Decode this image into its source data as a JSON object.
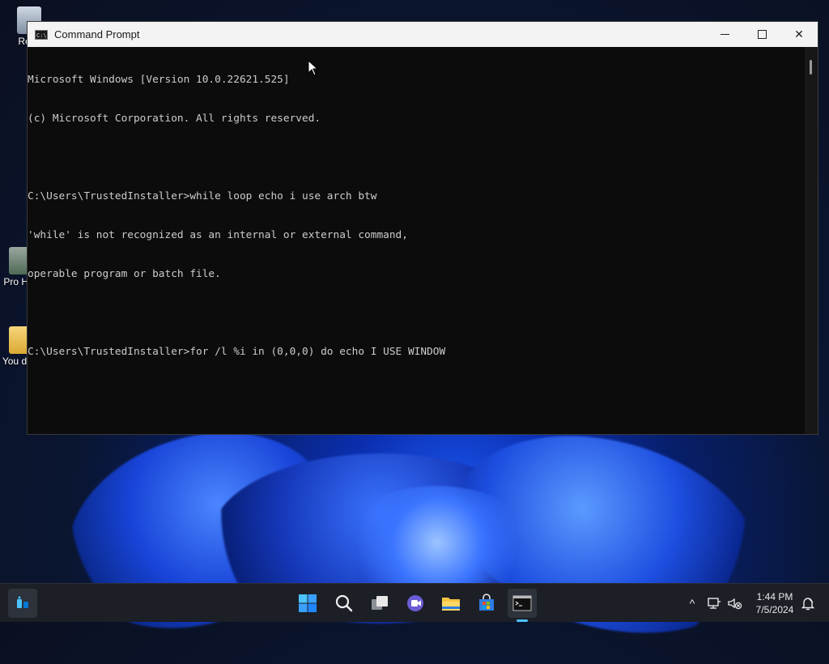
{
  "desktop": {
    "icons": [
      {
        "label": "Recy",
        "icon": "recycle-bin-icon"
      },
      {
        "label": "Pro Hac",
        "icon": "shortcut-icon"
      },
      {
        "label": "You dele",
        "icon": "folder-icon"
      }
    ]
  },
  "window": {
    "title": "Command Prompt",
    "icon": "console-icon",
    "controls": {
      "minimize": "minimize-icon",
      "maximize": "maximize-icon",
      "close": "close-icon",
      "close_glyph": "✕"
    }
  },
  "console": {
    "lines": [
      "Microsoft Windows [Version 10.0.22621.525]",
      "(c) Microsoft Corporation. All rights reserved.",
      "",
      "C:\\Users\\TrustedInstaller>while loop echo i use arch btw",
      "'while' is not recognized as an internal or external command,",
      "operable program or batch file.",
      "",
      "C:\\Users\\TrustedInstaller>for /l %i in (0,0,0) do echo I USE WINDOW"
    ],
    "text_color": "#cccccc",
    "background": "#0c0c0c"
  },
  "taskbar": {
    "apps": [
      {
        "name": "widgets",
        "icon": "widgets-icon"
      },
      {
        "name": "start",
        "icon": "windows-start-icon"
      },
      {
        "name": "search",
        "icon": "search-icon"
      },
      {
        "name": "task-view",
        "icon": "task-view-icon"
      },
      {
        "name": "chat",
        "icon": "chat-icon"
      },
      {
        "name": "file-explorer",
        "icon": "folder-icon"
      },
      {
        "name": "store",
        "icon": "store-icon"
      },
      {
        "name": "terminal",
        "icon": "terminal-icon",
        "active": true
      }
    ],
    "tray": {
      "chevron": "^",
      "time": "1:44 PM",
      "date": "7/5/2024"
    },
    "accent": "#4cc2ff"
  }
}
